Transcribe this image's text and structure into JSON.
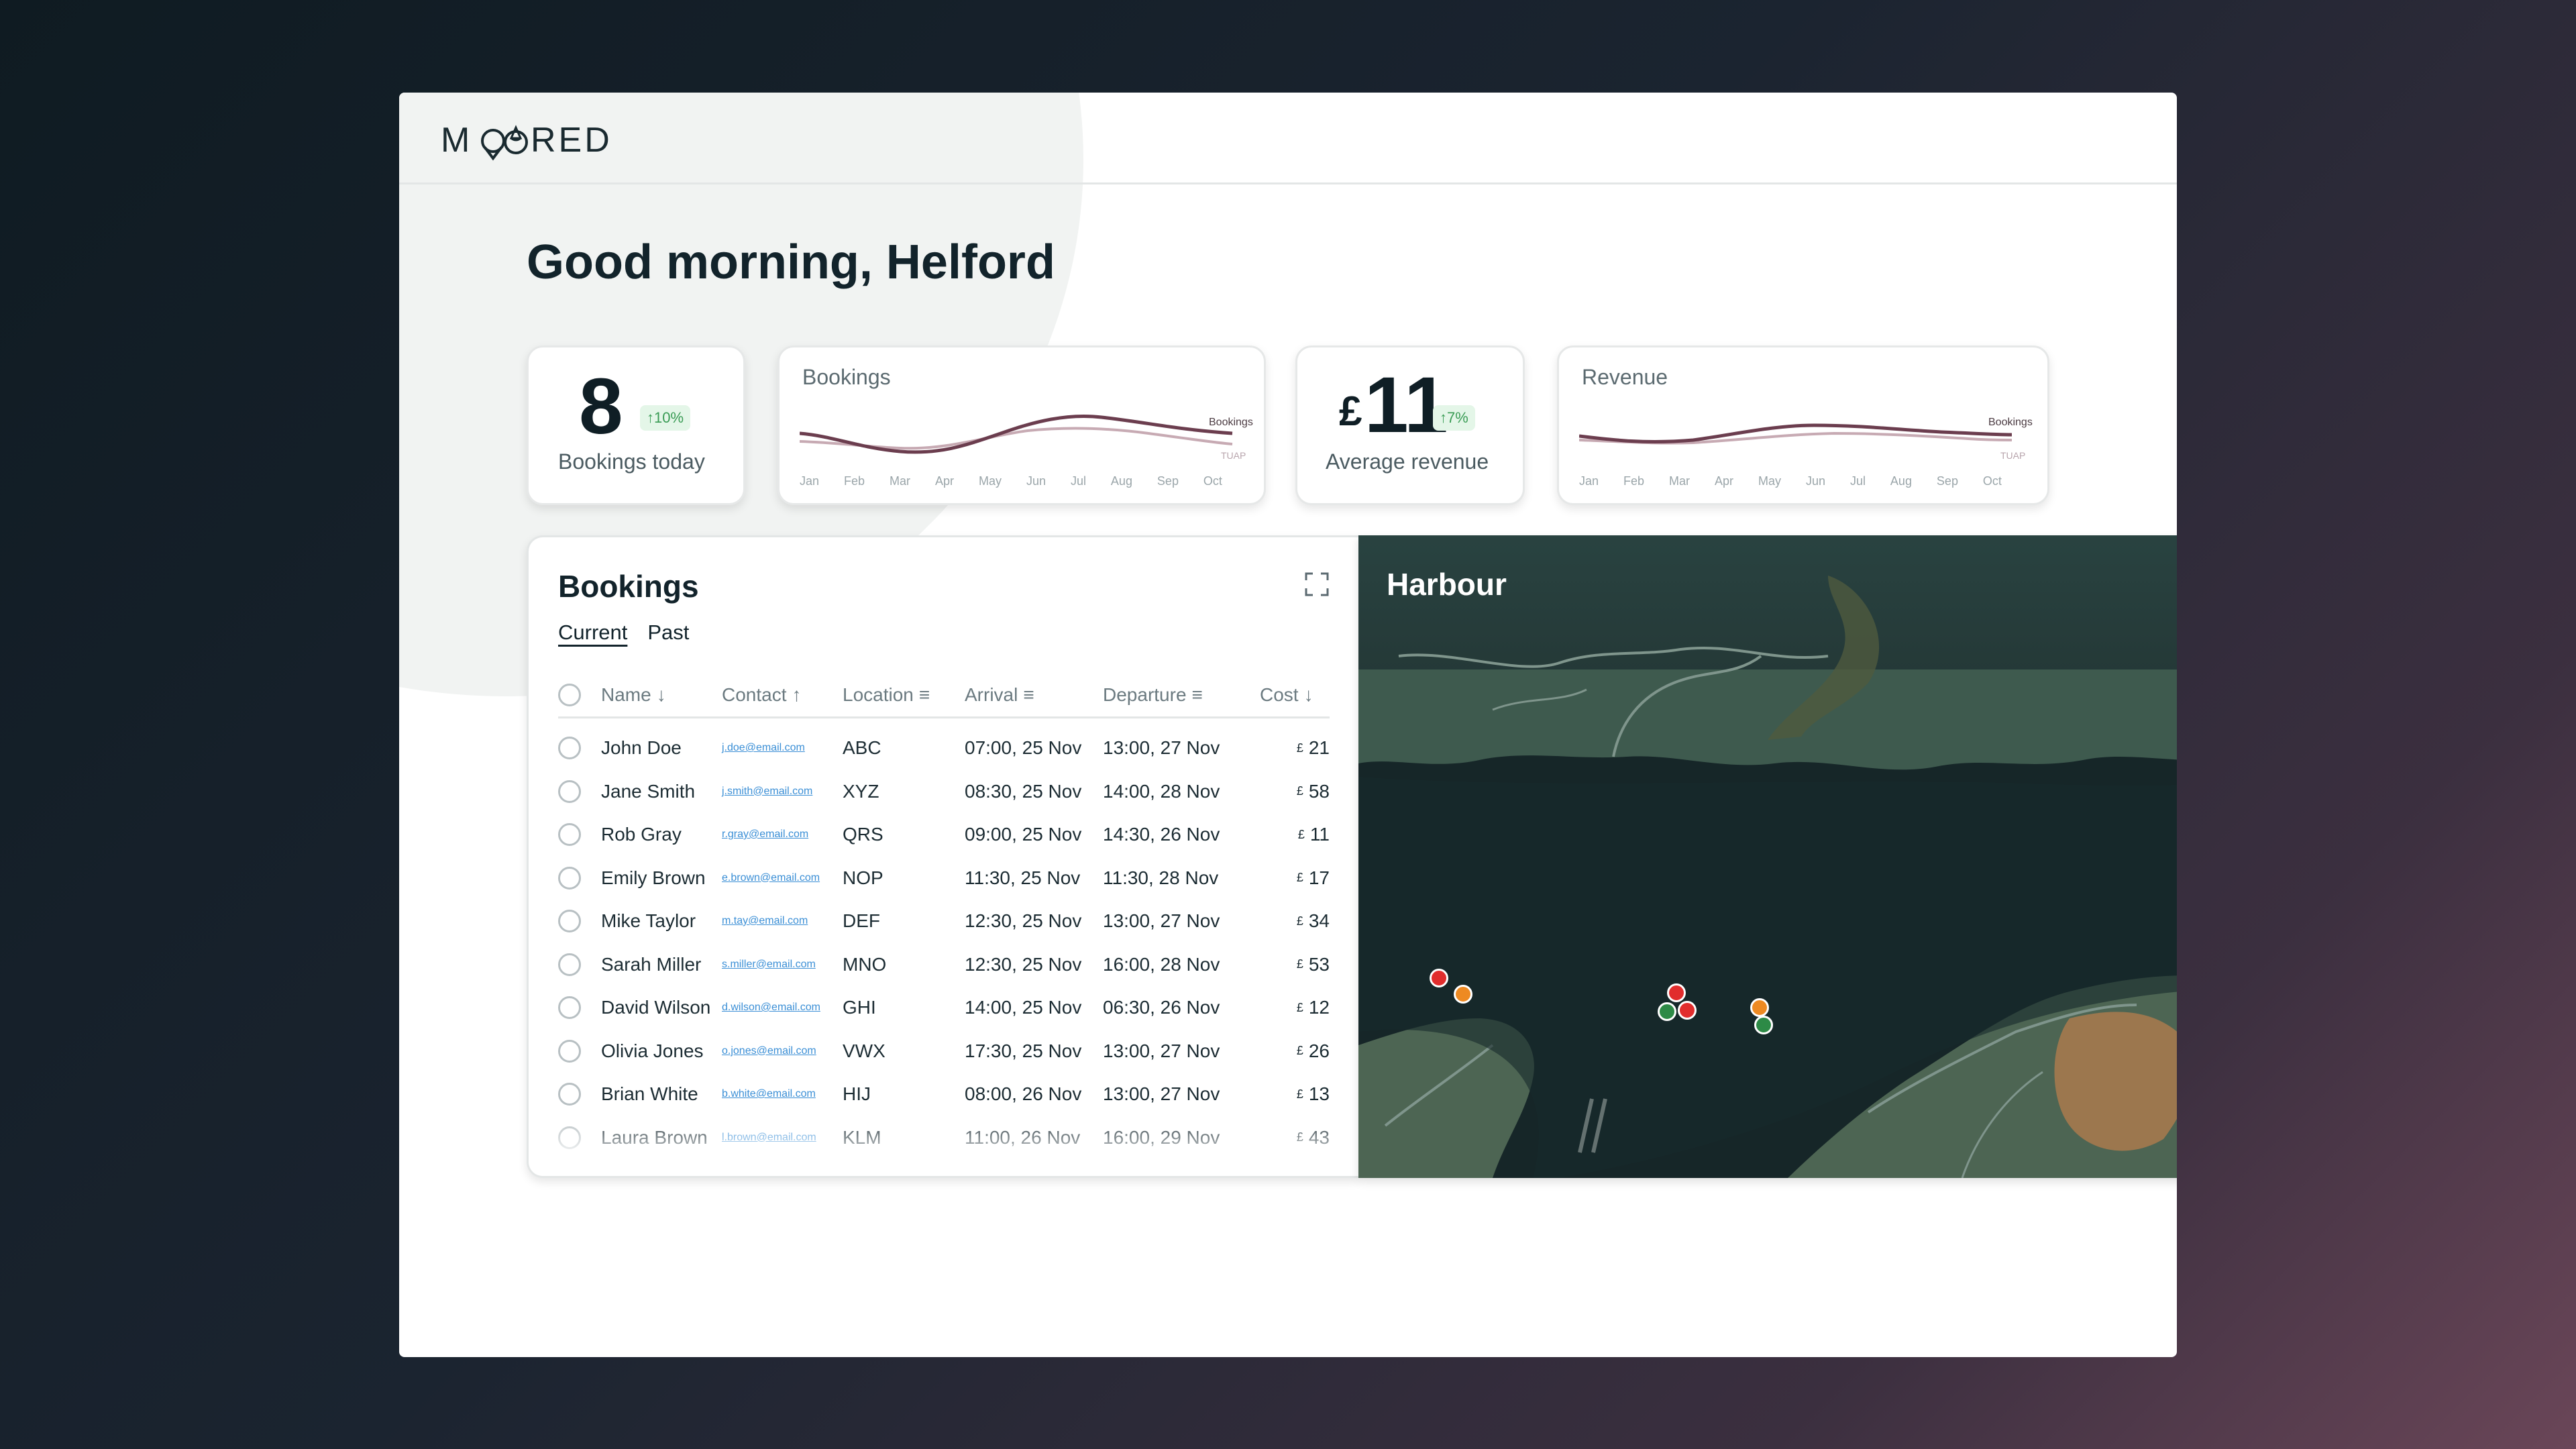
{
  "app": {
    "brand": "MOORED"
  },
  "greeting": "Good morning, Helford",
  "kpis": {
    "bookings_today": {
      "value": "8",
      "label": "Bookings today",
      "badge": "↑10%"
    },
    "average_revenue": {
      "currency": "£",
      "value": "11",
      "label": "Average revenue",
      "badge": "↑7%"
    }
  },
  "spark_bookings": {
    "title": "Bookings",
    "series_label": "Bookings",
    "compare_label": "TUAP",
    "months": [
      "Jan",
      "Feb",
      "Mar",
      "Apr",
      "May",
      "Jun",
      "Jul",
      "Aug",
      "Sep",
      "Oct"
    ]
  },
  "spark_revenue": {
    "title": "Revenue",
    "series_label": "Bookings",
    "compare_label": "TUAP",
    "months": [
      "Jan",
      "Feb",
      "Mar",
      "Apr",
      "May",
      "Jun",
      "Jul",
      "Aug",
      "Sep",
      "Oct"
    ]
  },
  "bookings": {
    "title": "Bookings",
    "tabs": {
      "current": "Current",
      "past": "Past"
    },
    "columns": {
      "name": "Name",
      "contact": "Contact",
      "location": "Location",
      "arrival": "Arrival",
      "departure": "Departure",
      "cost": "Cost"
    },
    "currency": "£",
    "rows": [
      {
        "name": "John Doe",
        "email": "j.doe@email.com",
        "location": "ABC",
        "arrival": "07:00, 25 Nov",
        "departure": "13:00, 27 Nov",
        "cost": "21"
      },
      {
        "name": "Jane Smith",
        "email": "j.smith@email.com",
        "location": "XYZ",
        "arrival": "08:30, 25 Nov",
        "departure": "14:00, 28 Nov",
        "cost": "58"
      },
      {
        "name": "Rob Gray",
        "email": "r.gray@email.com",
        "location": "QRS",
        "arrival": "09:00, 25 Nov",
        "departure": "14:30, 26 Nov",
        "cost": "11"
      },
      {
        "name": "Emily Brown",
        "email": "e.brown@email.com",
        "location": "NOP",
        "arrival": "11:30, 25 Nov",
        "departure": "11:30, 28 Nov",
        "cost": "17"
      },
      {
        "name": "Mike Taylor",
        "email": "m.tay@email.com",
        "location": "DEF",
        "arrival": "12:30, 25 Nov",
        "departure": "13:00, 27 Nov",
        "cost": "34"
      },
      {
        "name": "Sarah Miller",
        "email": "s.miller@email.com",
        "location": "MNO",
        "arrival": "12:30, 25 Nov",
        "departure": "16:00, 28 Nov",
        "cost": "53"
      },
      {
        "name": "David Wilson",
        "email": "d.wilson@email.com",
        "location": "GHI",
        "arrival": "14:00, 25 Nov",
        "departure": "06:30, 26 Nov",
        "cost": "12"
      },
      {
        "name": "Olivia Jones",
        "email": "o.jones@email.com",
        "location": "VWX",
        "arrival": "17:30, 25 Nov",
        "departure": "13:00, 27 Nov",
        "cost": "26"
      },
      {
        "name": "Brian White",
        "email": "b.white@email.com",
        "location": "HIJ",
        "arrival": "08:00, 26 Nov",
        "departure": "13:00, 27 Nov",
        "cost": "13"
      },
      {
        "name": "Laura Brown",
        "email": "l.brown@email.com",
        "location": "KLM",
        "arrival": "11:00, 26 Nov",
        "departure": "16:00, 29 Nov",
        "cost": "43"
      }
    ]
  },
  "harbour": {
    "title": "Harbour",
    "pin_colors": {
      "red": "#e12d2d",
      "orange": "#ee8a22",
      "green": "#2d8a46"
    }
  },
  "colors": {
    "accent": "#6b3d4e",
    "compare": "#c7aab3",
    "badge_bg": "#e4f6e8",
    "badge_fg": "#3a9c55"
  }
}
